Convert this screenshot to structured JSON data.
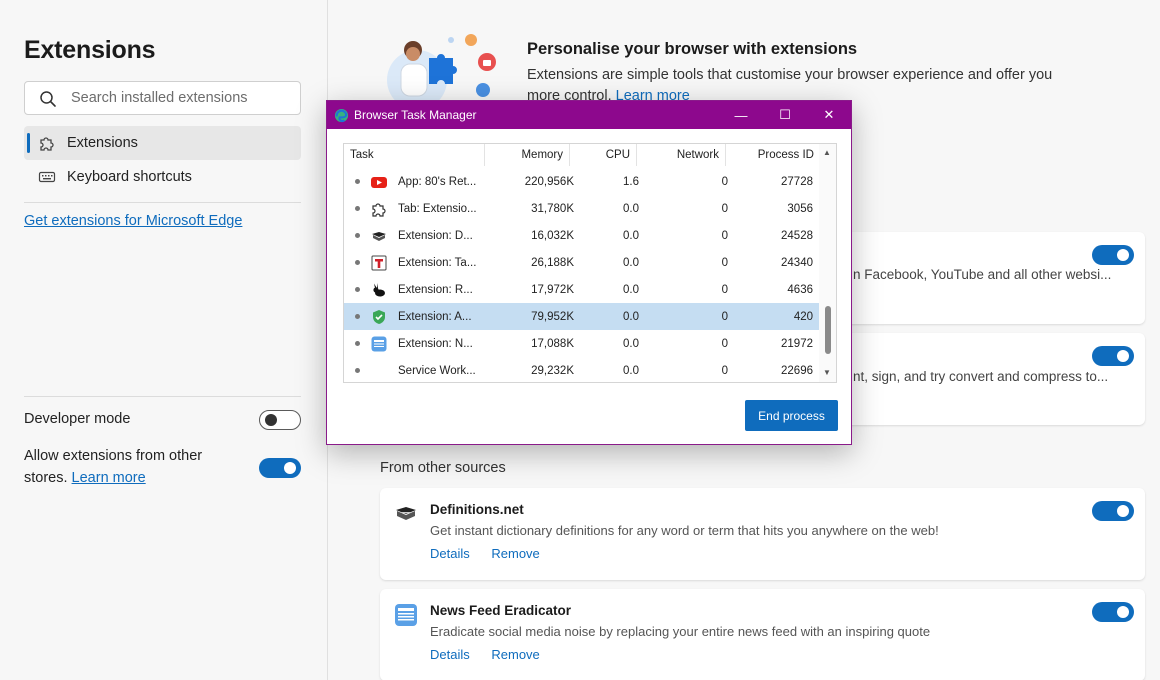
{
  "sidebar": {
    "title": "Extensions",
    "search_placeholder": "Search installed extensions",
    "nav": [
      {
        "label": "Extensions",
        "active": true
      },
      {
        "label": "Keyboard shortcuts",
        "active": false
      }
    ],
    "get_extensions_link": "Get extensions for Microsoft Edge",
    "developer_mode": {
      "label": "Developer mode",
      "enabled": false
    },
    "allow_other_stores": {
      "label_line1": "Allow extensions from other",
      "label_line2": "stores.",
      "link": "Learn more",
      "enabled": true
    }
  },
  "main": {
    "hero_title": "Personalise your browser with extensions",
    "hero_desc": "Extensions are simple tools that customise your browser experience and offer you more control.",
    "hero_link": "Learn more",
    "card1_partial": "n Facebook, YouTube and all other websi...",
    "card2_partial": "nt, sign, and try convert and compress to...",
    "section_title": "From other sources",
    "extensions": [
      {
        "name": "Definitions.net",
        "desc": "Get instant dictionary definitions for any word or term that hits you anywhere on the web!",
        "details": "Details",
        "remove": "Remove",
        "enabled": true
      },
      {
        "name": "News Feed Eradicator",
        "desc": "Eradicate social media noise by replacing your entire news feed with an inspiring quote",
        "details": "Details",
        "remove": "Remove",
        "enabled": true
      }
    ]
  },
  "task_manager": {
    "title": "Browser Task Manager",
    "columns": [
      "Task",
      "Memory",
      "CPU",
      "Network",
      "Process ID"
    ],
    "rows": [
      {
        "icon": "youtube-icon",
        "task": "App: 80's Ret...",
        "memory": "220,956K",
        "cpu": "1.6",
        "network": "0",
        "pid": "27728"
      },
      {
        "icon": "extension-puzzle-icon",
        "task": "Tab: Extensio...",
        "memory": "31,780K",
        "cpu": "0.0",
        "network": "0",
        "pid": "3056"
      },
      {
        "icon": "book-icon",
        "task": "Extension: D...",
        "memory": "16,032K",
        "cpu": "0.0",
        "network": "0",
        "pid": "24528"
      },
      {
        "icon": "t-logo-icon",
        "task": "Extension: Ta...",
        "memory": "26,188K",
        "cpu": "0.0",
        "network": "0",
        "pid": "24340"
      },
      {
        "icon": "rabbit-icon",
        "task": "Extension: R...",
        "memory": "17,972K",
        "cpu": "0.0",
        "network": "0",
        "pid": "4636"
      },
      {
        "icon": "shield-icon",
        "task": "Extension: A...",
        "memory": "79,952K",
        "cpu": "0.0",
        "network": "0",
        "pid": "420",
        "selected": true
      },
      {
        "icon": "newspaper-icon",
        "task": "Extension: N...",
        "memory": "17,088K",
        "cpu": "0.0",
        "network": "0",
        "pid": "21972"
      },
      {
        "icon": "none",
        "task": "Service Work...",
        "memory": "29,232K",
        "cpu": "0.0",
        "network": "0",
        "pid": "22696"
      }
    ],
    "end_process_label": "End process",
    "minimize": "—",
    "maximize": "☐",
    "close": "✕"
  },
  "colors": {
    "accent": "#0f6cbd",
    "titlebar": "#8d088d",
    "selected_row": "#c5ddf2"
  }
}
